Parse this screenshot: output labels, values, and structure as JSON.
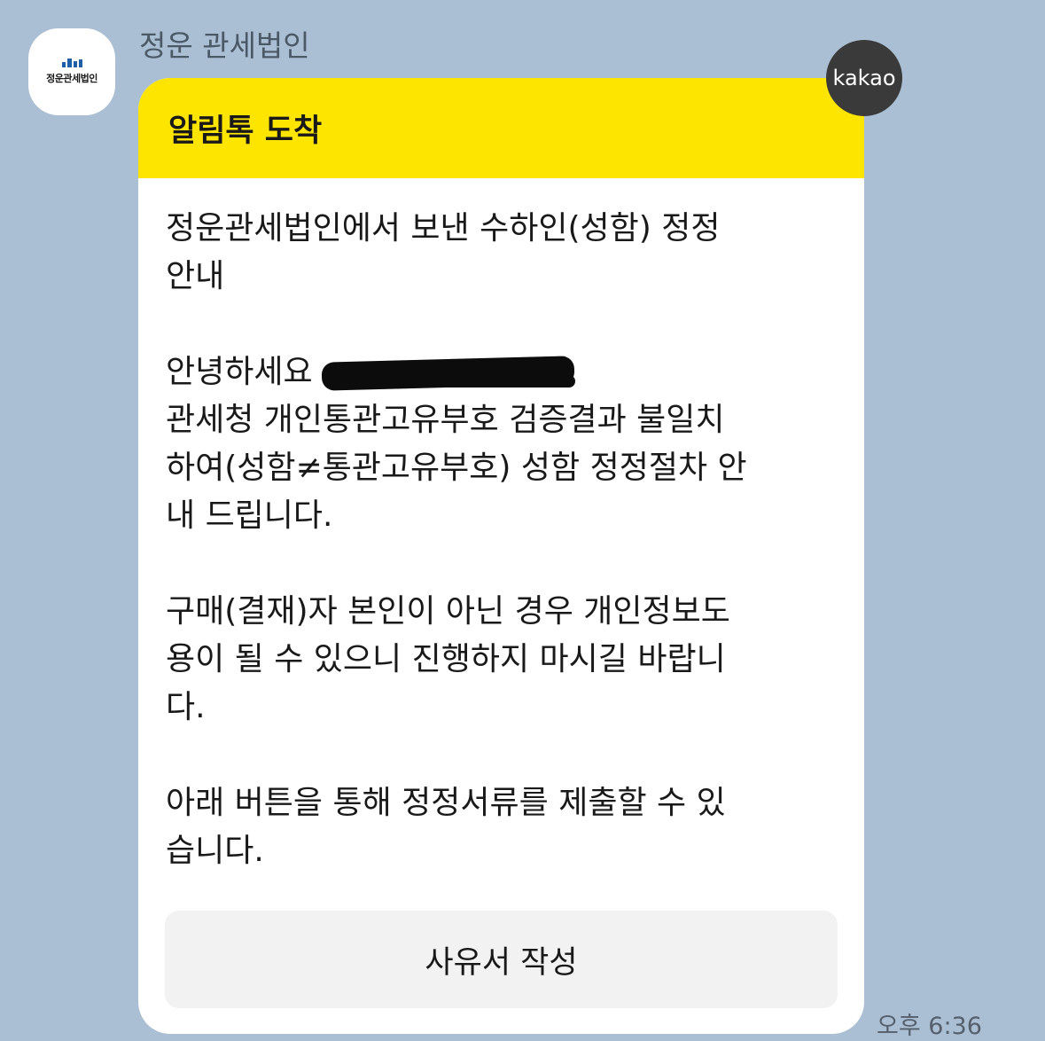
{
  "sender": {
    "name": "정운 관세법인",
    "avatar_text": "정운관세법인"
  },
  "message": {
    "header_title": "알림톡 도착",
    "paragraphs": [
      {
        "lines": [
          "정운관세법인에서 보낸 수하인(성함) 정정",
          "안내"
        ]
      },
      {
        "greeting": "안녕하세요",
        "lines": [
          "관세청 개인통관고유부호 검증결과 불일치",
          "하여(성함≠통관고유부호) 성함 정정절차 안",
          "내 드립니다."
        ]
      },
      {
        "lines": [
          "구매(결재)자 본인이 아닌 경우 개인정보도",
          "용이 될 수 있으니 진행하지 마시길 바랍니",
          "다."
        ]
      },
      {
        "lines": [
          "아래 버튼을 통해 정정서류를 제출할 수 있",
          "습니다."
        ]
      }
    ],
    "button_label": "사유서 작성",
    "time": "오후 6:36"
  },
  "badge": {
    "label": "kakao"
  },
  "colors": {
    "background": "#abbfd4",
    "header_yellow": "#fee500",
    "badge": "#3a3a3a"
  }
}
